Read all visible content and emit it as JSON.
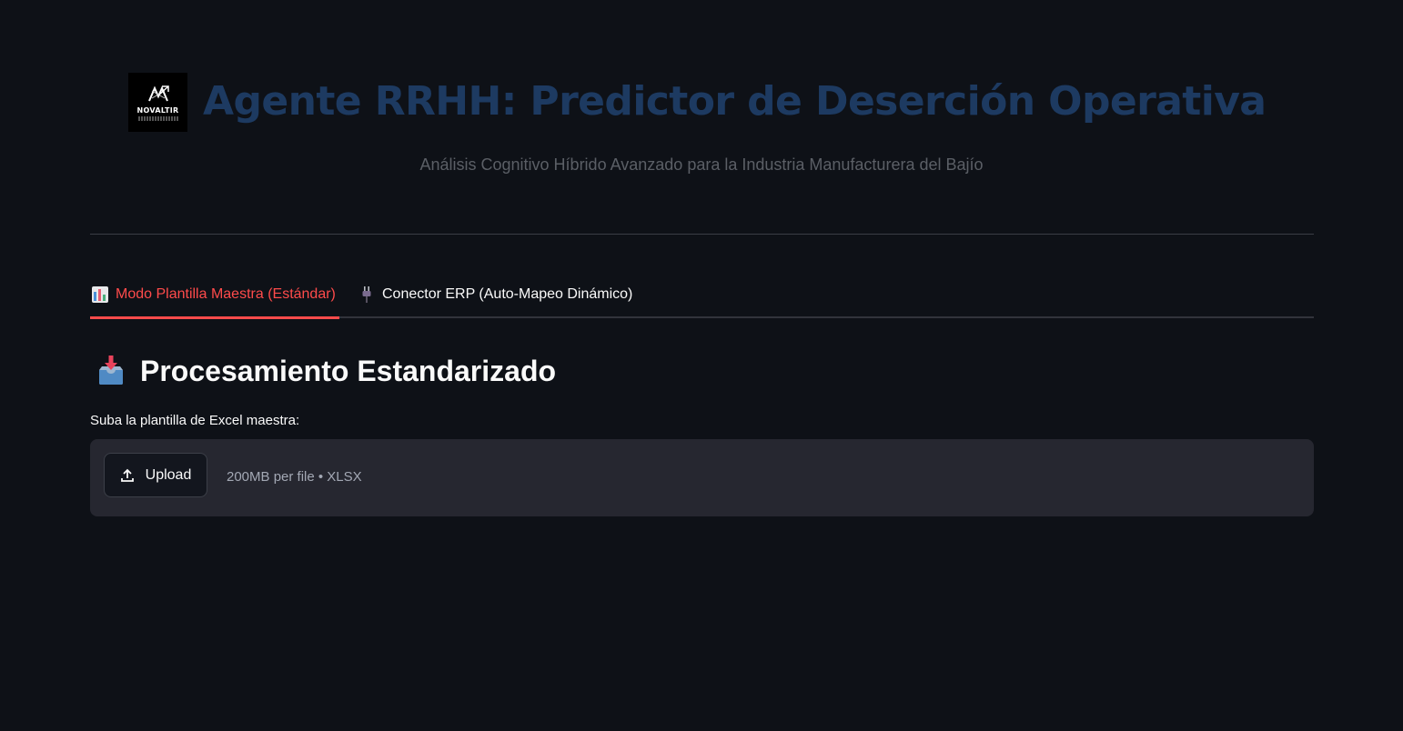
{
  "header": {
    "logo_text": "NOVALTIR",
    "title": "Agente RRHH: Predictor de Deserción Operativa",
    "subtitle": "Análisis Cognitivo Híbrido Avanzado para la Industria Manufacturera del Bajío"
  },
  "tabs": [
    {
      "label": "Modo Plantilla Maestra (Estándar)",
      "icon": "bar-chart-icon",
      "active": true
    },
    {
      "label": "Conector ERP (Auto-Mapeo Dinámico)",
      "icon": "plug-icon",
      "active": false
    }
  ],
  "main": {
    "section_icon": "inbox-tray-icon",
    "section_title": "Procesamiento Estandarizado",
    "upload_label": "Suba la plantilla de Excel maestra:",
    "upload_button": "Upload",
    "upload_hint": "200MB per file • XLSX"
  },
  "colors": {
    "background": "#0e1117",
    "title": "#1d3a61",
    "accent": "#ff4b4b",
    "dropzone": "#262730"
  }
}
